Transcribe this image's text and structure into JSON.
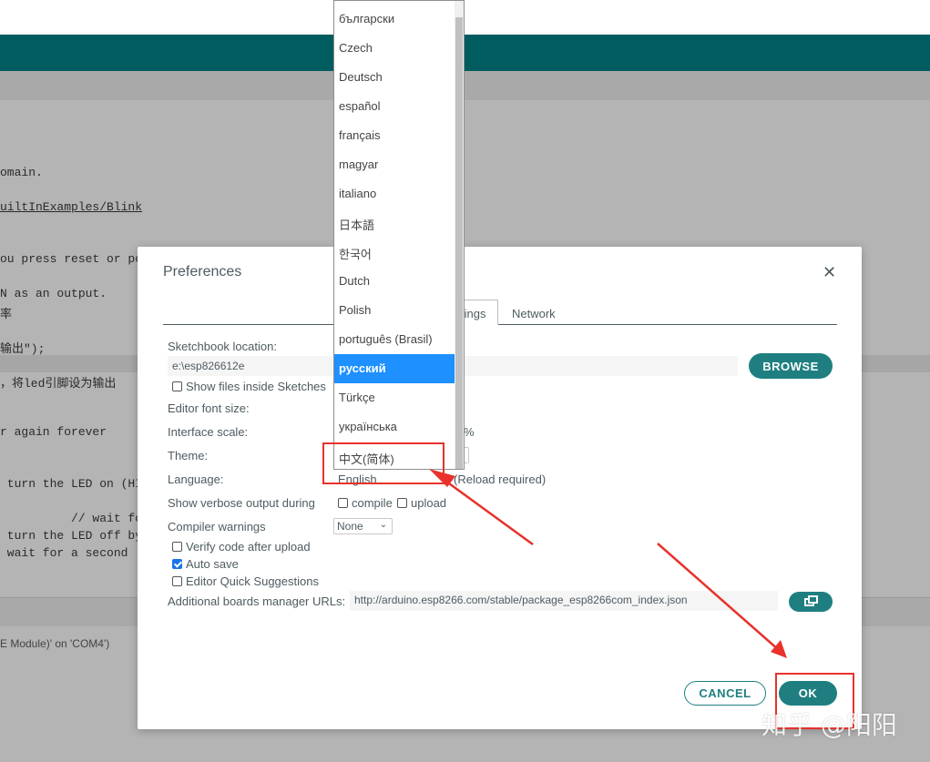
{
  "editor": {
    "code_lines": [
      "omain.",
      "uiltInExamples/Blink",
      "ou press reset or po",
      "N as an output.",
      "率",
      "输出\");",
      "，将led引脚设为输出",
      "r again forever",
      " turn the LED on (HI",
      "          // wait for",
      " turn the LED off by",
      " wait for a second"
    ],
    "status_text": "E Module)' on 'COM4')"
  },
  "dialog": {
    "title": "Preferences",
    "tab_settings_label": "tings",
    "tab_network_label": "Network",
    "sketchbook_label": "Sketchbook location:",
    "sketchbook_value": "e:\\esp826612e",
    "browse_label": "BROWSE",
    "show_files_label": "Show files inside Sketches",
    "font_size_label": "Editor font size:",
    "scale_label": "Interface scale:",
    "scale_percent": "%",
    "theme_label": "Theme:",
    "language_label": "Language:",
    "language_value": "English",
    "reload_note": "(Reload required)",
    "verbose_label": "Show verbose output during",
    "verbose_compile": "compile",
    "verbose_upload": "upload",
    "warnings_label": "Compiler warnings",
    "warnings_value": "None",
    "verify_label": "Verify code after upload",
    "autosave_label": "Auto save",
    "autosave_checked": true,
    "quick_suggest_label": "Editor Quick Suggestions",
    "urls_label": "Additional boards manager URLs:",
    "urls_value": "http://arduino.esp8266.com/stable/package_esp8266com_index.json",
    "cancel_label": "CANCEL",
    "ok_label": "OK"
  },
  "language_dropdown": {
    "options": [
      "български",
      "Czech",
      "Deutsch",
      "español",
      "français",
      "magyar",
      "italiano",
      "日本語",
      "한국어",
      "Dutch",
      "Polish",
      "português (Brasil)",
      "русский",
      "Türkçe",
      "українська",
      "中文(简体)"
    ],
    "highlighted": "русский"
  },
  "annotations": {
    "color": "#e8322b"
  },
  "watermark": "知乎 @阳阳",
  "colors": {
    "accent": "#1f7f80",
    "toolbar": "#005c5f",
    "selection": "#1e90ff"
  }
}
